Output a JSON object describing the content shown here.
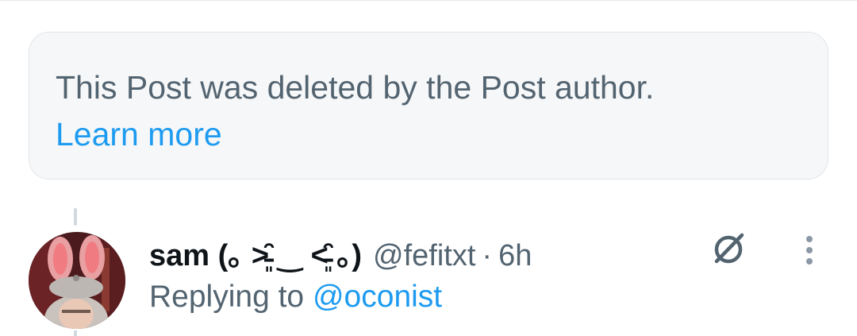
{
  "deleted_notice": {
    "text": "This Post was deleted by the Post author.",
    "link_label": "Learn more"
  },
  "reply": {
    "display_name": "sam (｡ ˃̵͈̑ ‿ ˂̵͈̑ ｡)",
    "handle": "@fefitxt",
    "separator": "·",
    "time": "6h",
    "replying_prefix": "Replying to",
    "replying_to": "@oconist"
  },
  "icons": {
    "grok": "grok-slash-circle-icon",
    "more": "vertical-ellipsis-icon"
  },
  "colors": {
    "link": "#1d9bf0",
    "secondary_text": "#536471",
    "primary_text": "#0f1419",
    "notice_bg": "#f6f7f8"
  }
}
